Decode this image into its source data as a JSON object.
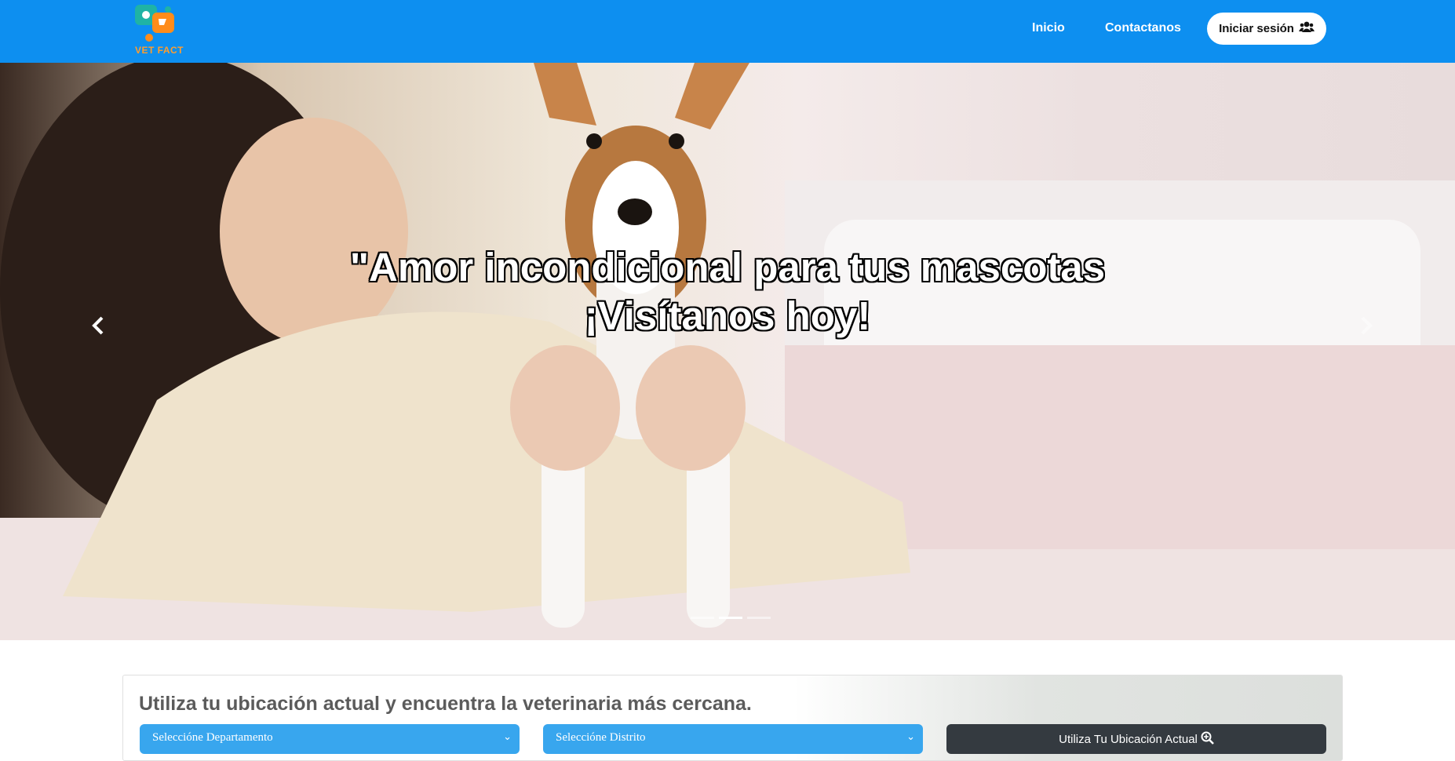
{
  "brand": {
    "logo_text": "VET FACT"
  },
  "nav": {
    "links": [
      "Inicio",
      "Contactanos"
    ],
    "login_label": "Iniciar sesión",
    "login_icon": "users-icon"
  },
  "hero": {
    "caption_line1": "\"Amor incondicional para tus mascotas",
    "caption_line2": "¡Visítanos hoy!",
    "slide_count": 3,
    "active_slide": 2,
    "prev_icon": "chevron-left-icon",
    "next_icon": "chevron-right-icon"
  },
  "search": {
    "title": "Utiliza tu ubicación actual y encuentra la veterinaria más cercana.",
    "departamento_placeholder": "Seleccióne Departamento",
    "distrito_placeholder": "Seleccióne Distrito",
    "locate_label": "Utiliza Tu Ubicación Actual",
    "locate_icon": "search-plus-icon"
  },
  "colors": {
    "navbar": "#0d8ff0",
    "select": "#38a6ee",
    "locate_button": "#343a40",
    "title_text": "#5b5b5b",
    "logo_accent": "#ff9d2e"
  }
}
